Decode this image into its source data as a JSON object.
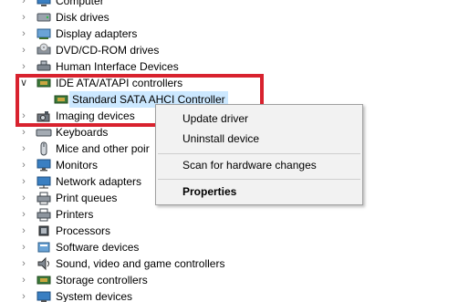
{
  "tree": {
    "items": [
      {
        "label": "Computer",
        "icon": "computer-icon"
      },
      {
        "label": "Disk drives",
        "icon": "disk-drive-icon"
      },
      {
        "label": "Display adapters",
        "icon": "display-adapter-icon"
      },
      {
        "label": "DVD/CD-ROM drives",
        "icon": "dvd-drive-icon"
      },
      {
        "label": "Human Interface Devices",
        "icon": "hid-icon"
      },
      {
        "label": "IDE ATA/ATAPI controllers",
        "icon": "ide-controller-icon",
        "expanded": true
      },
      {
        "label": "Standard SATA AHCI Controller",
        "icon": "sata-controller-icon",
        "child": true,
        "selected": true
      },
      {
        "label": "Imaging devices",
        "icon": "imaging-device-icon"
      },
      {
        "label": "Keyboards",
        "icon": "keyboard-icon"
      },
      {
        "label": "Mice and other poir",
        "icon": "mouse-icon"
      },
      {
        "label": "Monitors",
        "icon": "monitor-icon"
      },
      {
        "label": "Network adapters",
        "icon": "network-adapter-icon"
      },
      {
        "label": "Print queues",
        "icon": "print-queue-icon"
      },
      {
        "label": "Printers",
        "icon": "printer-icon"
      },
      {
        "label": "Processors",
        "icon": "processor-icon"
      },
      {
        "label": "Software devices",
        "icon": "software-device-icon"
      },
      {
        "label": "Sound, video and game controllers",
        "icon": "sound-icon"
      },
      {
        "label": "Storage controllers",
        "icon": "storage-controller-icon"
      },
      {
        "label": "System devices",
        "icon": "system-device-icon"
      }
    ]
  },
  "context_menu": {
    "update_driver": "Update driver",
    "uninstall_device": "Uninstall device",
    "scan_hardware": "Scan for hardware changes",
    "properties": "Properties"
  },
  "colors": {
    "highlight_border": "#d8222e",
    "selection": "#cce8ff",
    "menu_bg": "#f2f2f2"
  }
}
